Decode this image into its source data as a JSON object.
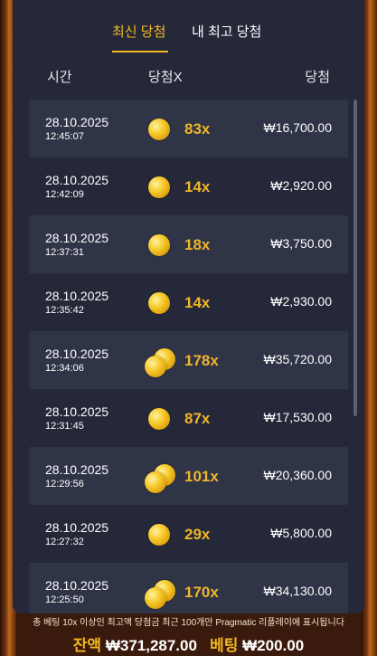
{
  "tabs": [
    {
      "label": "최신 당첨",
      "active": true
    },
    {
      "label": "내 최고 당첨",
      "active": false
    }
  ],
  "header": {
    "time": "시간",
    "multiplier": "당첨X",
    "win": "당첨"
  },
  "rows": [
    {
      "date": "28.10.2025",
      "time": "12:45:07",
      "mult": "83x",
      "amount": "₩16,700.00",
      "coins": 1
    },
    {
      "date": "28.10.2025",
      "time": "12:42:09",
      "mult": "14x",
      "amount": "₩2,920.00",
      "coins": 1
    },
    {
      "date": "28.10.2025",
      "time": "12:37:31",
      "mult": "18x",
      "amount": "₩3,750.00",
      "coins": 1
    },
    {
      "date": "28.10.2025",
      "time": "12:35:42",
      "mult": "14x",
      "amount": "₩2,930.00",
      "coins": 1
    },
    {
      "date": "28.10.2025",
      "time": "12:34:06",
      "mult": "178x",
      "amount": "₩35,720.00",
      "coins": 2
    },
    {
      "date": "28.10.2025",
      "time": "12:31:45",
      "mult": "87x",
      "amount": "₩17,530.00",
      "coins": 1
    },
    {
      "date": "28.10.2025",
      "time": "12:29:56",
      "mult": "101x",
      "amount": "₩20,360.00",
      "coins": 2
    },
    {
      "date": "28.10.2025",
      "time": "12:27:32",
      "mult": "29x",
      "amount": "₩5,800.00",
      "coins": 1
    },
    {
      "date": "28.10.2025",
      "time": "12:25:50",
      "mult": "170x",
      "amount": "₩34,130.00",
      "coins": 2
    }
  ],
  "footer": {
    "note": "총 베팅 10x 이상인 최고액 당첨금 최근 100개만 Pragmatic 리플레이에 표시됩니다",
    "balance_label": "잔액",
    "balance_value": "₩371,287.00",
    "bet_label": "베팅",
    "bet_value": "₩200.00"
  },
  "colors": {
    "accent": "#f3b823",
    "panel": "#242838",
    "row_alt": "#2f3447"
  },
  "icons": {
    "coin": "gold-coin-icon",
    "coin_stack": "gold-coins-icon"
  }
}
